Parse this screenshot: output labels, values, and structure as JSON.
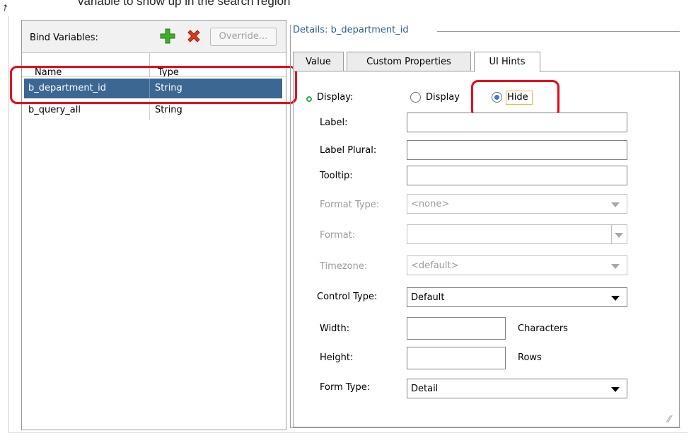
{
  "top_text": "variable to show up in the search region",
  "bind_panel": {
    "title": "Bind Variables:",
    "add_icon": "green-plus-icon",
    "delete_icon": "red-x-icon",
    "override_label": "Override...",
    "columns": {
      "name": "Name",
      "type": "Type"
    },
    "rows": [
      {
        "name": "b_department_id",
        "type": "String",
        "selected": true
      },
      {
        "name": "b_query_all",
        "type": "String",
        "selected": false
      }
    ]
  },
  "details": {
    "title": "Details: b_department_id",
    "tabs": [
      {
        "label": "Value",
        "active": false
      },
      {
        "label": "Custom Properties",
        "active": false
      },
      {
        "label": "UI Hints",
        "active": true
      }
    ],
    "display": {
      "label": "Display:",
      "option_display": "Display",
      "option_hide": "Hide",
      "selected": "Hide"
    },
    "fields": {
      "label": {
        "label": "Label:",
        "value": ""
      },
      "label_plural": {
        "label": "Label Plural:",
        "value": ""
      },
      "tooltip": {
        "label": "Tooltip:",
        "value": ""
      },
      "format_type": {
        "label": "Format Type:",
        "value": "<none>"
      },
      "format": {
        "label": "Format:",
        "value": ""
      },
      "timezone": {
        "label": "Timezone:",
        "value": "<default>"
      },
      "control_type": {
        "label": "Control Type:",
        "value": "Default"
      },
      "width": {
        "label": "Width:",
        "value": "",
        "unit": "Characters"
      },
      "height": {
        "label": "Height:",
        "value": "",
        "unit": "Rows"
      },
      "form_type": {
        "label": "Form Type:",
        "value": "Detail"
      }
    }
  },
  "colors": {
    "selected_row": "#3c6793",
    "annotation": "#e8001c",
    "details_title": "#2e5d8f",
    "status_dot": "#3aa34a",
    "radio_selected": "#3d7ccb"
  }
}
